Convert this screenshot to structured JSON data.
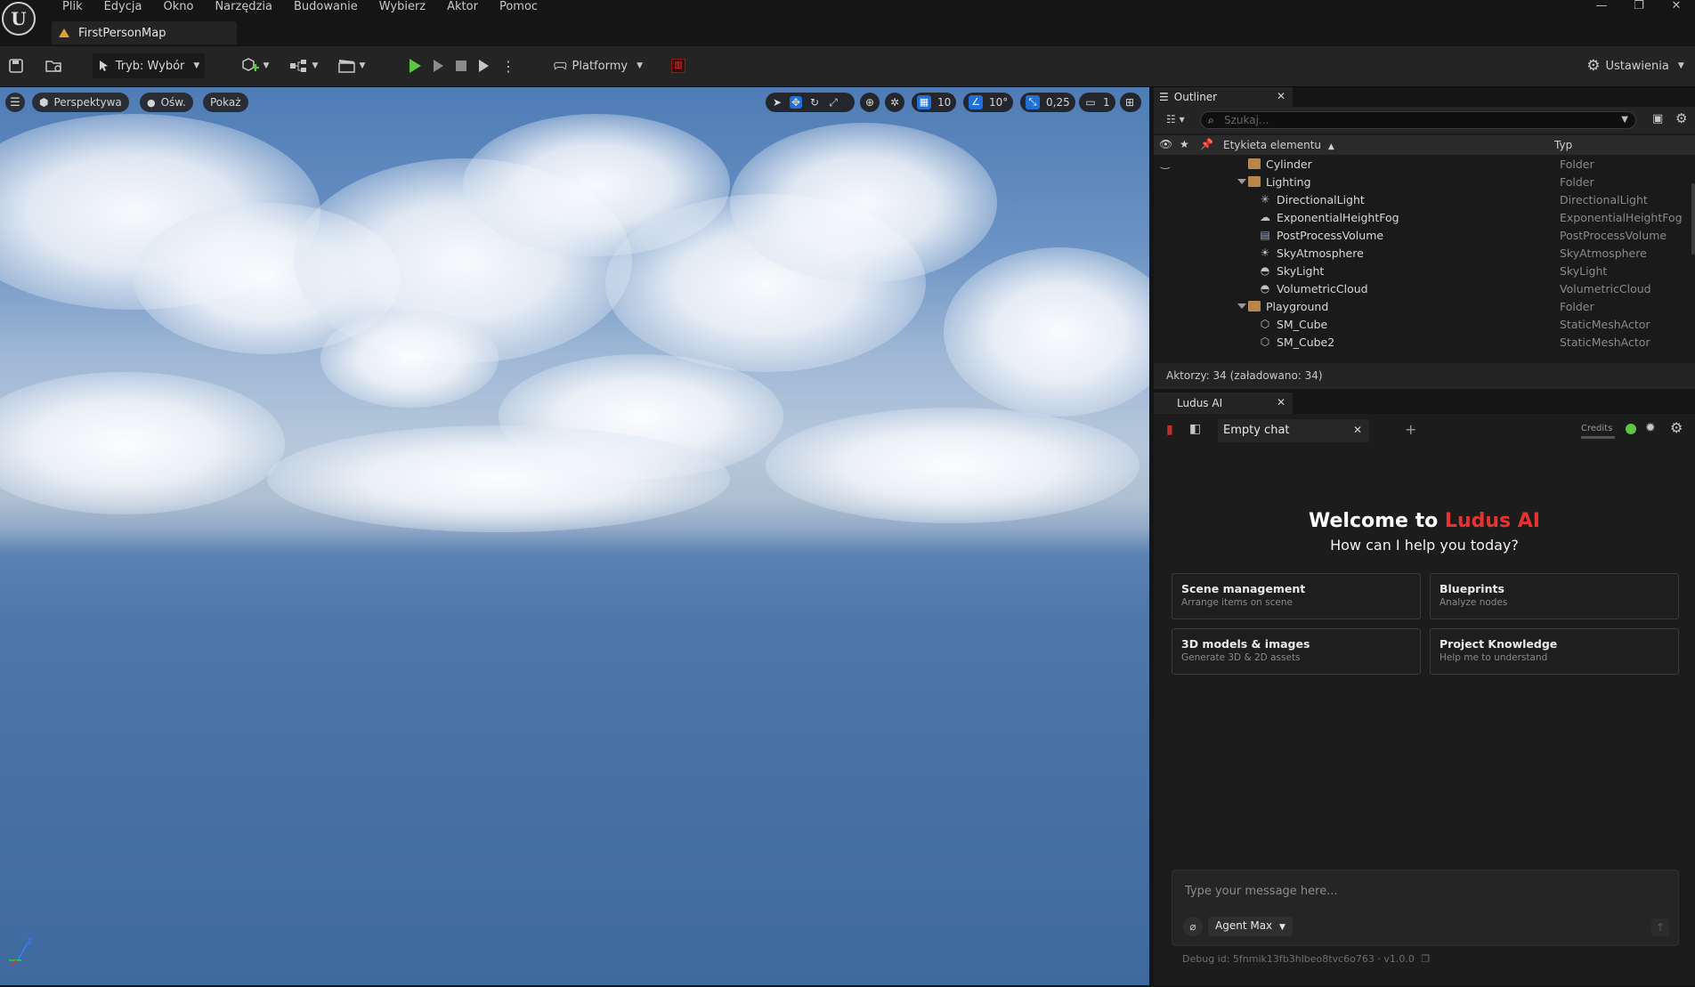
{
  "menu": [
    "Plik",
    "Edycja",
    "Okno",
    "Narzędzia",
    "Budowanie",
    "Wybierz",
    "Aktor",
    "Pomoc"
  ],
  "window_controls": {
    "minimize": "—",
    "restore": "❐",
    "close": "✕"
  },
  "document_tab": {
    "title": "FirstPersonMap"
  },
  "toolbar": {
    "mode_label": "Tryb: Wybór",
    "platforms_label": "Platformy",
    "settings_label": "Ustawienia"
  },
  "viewport": {
    "perspective_label": "Perspektywa",
    "lighting_label": "Ośw.",
    "show_label": "Pokaż",
    "grid_snap": "10",
    "rotation_snap": "10°",
    "scale_snap": "0,25",
    "camera_speed": "1",
    "axis_z": "Z"
  },
  "outliner": {
    "tab_title": "Outliner",
    "search_placeholder": "Szukaj...",
    "col_label": "Etykieta elementu",
    "col_type": "Typ",
    "rows": [
      {
        "name": "Cylinder",
        "type": "Folder"
      },
      {
        "name": "Lighting",
        "type": "Folder"
      },
      {
        "name": "DirectionalLight",
        "type": "DirectionalLight"
      },
      {
        "name": "ExponentialHeightFog",
        "type": "ExponentialHeightFog"
      },
      {
        "name": "PostProcessVolume",
        "type": "PostProcessVolume"
      },
      {
        "name": "SkyAtmosphere",
        "type": "SkyAtmosphere"
      },
      {
        "name": "SkyLight",
        "type": "SkyLight"
      },
      {
        "name": "VolumetricCloud",
        "type": "VolumetricCloud"
      },
      {
        "name": "Playground",
        "type": "Folder"
      },
      {
        "name": "SM_Cube",
        "type": "StaticMeshActor"
      },
      {
        "name": "SM_Cube2",
        "type": "StaticMeshActor"
      }
    ],
    "status": "Aktorzy: 34 (załadowano: 34)"
  },
  "ludus": {
    "tab_title": "Ludus AI",
    "chat_tab": "Empty chat",
    "credits_label": "Credits",
    "welcome_prefix": "Welcome to ",
    "welcome_brand": "Ludus AI",
    "subtitle": "How can I help you today?",
    "cards": [
      {
        "title": "Scene management",
        "subtitle": "Arrange items on scene"
      },
      {
        "title": "Blueprints",
        "subtitle": "Analyze nodes"
      },
      {
        "title": "3D models & images",
        "subtitle": "Generate 3D & 2D assets"
      },
      {
        "title": "Project Knowledge",
        "subtitle": "Help me to understand"
      }
    ],
    "message_placeholder": "Type your message here...",
    "agent_label": "Agent Max",
    "debug_text": "Debug id: 5fnmik13fb3hlbeo8tvc6o763 · v1.0.0"
  },
  "colors": {
    "accent_red": "#e8322f",
    "play_green": "#5fc348",
    "select_blue": "#1f6fd6"
  }
}
